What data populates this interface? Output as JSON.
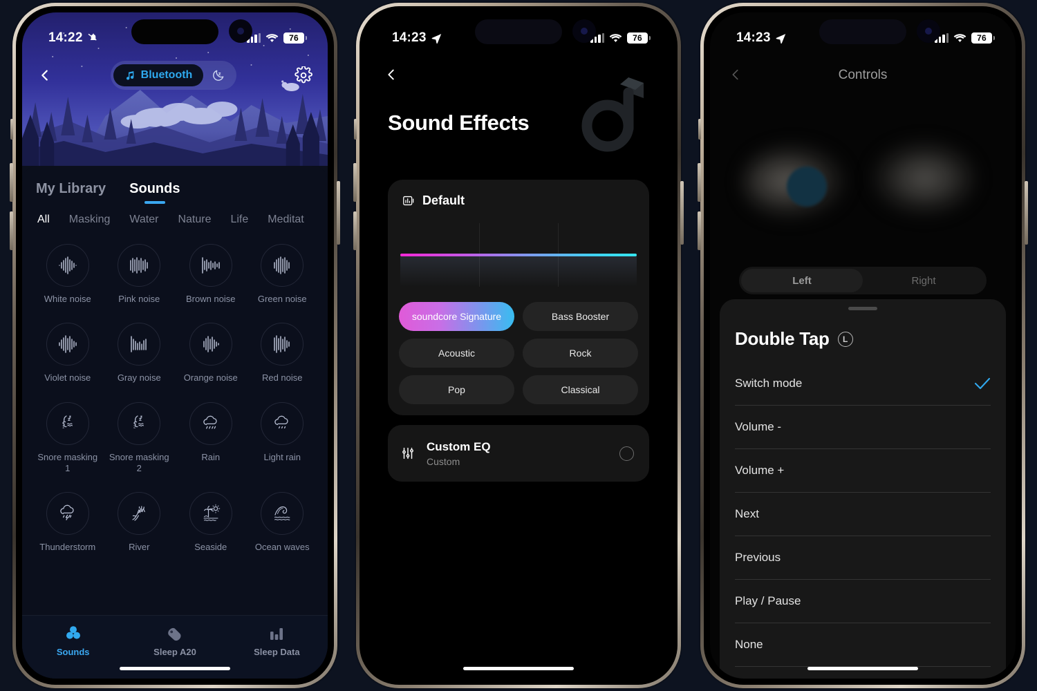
{
  "meta": {
    "background": "#0d1320",
    "accent_blue": "#3aa7f0"
  },
  "phone1": {
    "status": {
      "time": "14:22",
      "mute_icon": "bell-slash-icon",
      "battery": "76",
      "wifi_icon": "wifi-icon",
      "cell_icon": "cellular-icon"
    },
    "topbar": {
      "back_icon": "chevron-left-icon",
      "mode_label": "Bluetooth",
      "music_icon": "music-note-icon",
      "moon_icon": "moon-sleep-icon",
      "settings_icon": "gear-icon"
    },
    "tabs": [
      {
        "label": "My Library",
        "active": false
      },
      {
        "label": "Sounds",
        "active": true
      }
    ],
    "categories": [
      {
        "label": "All",
        "active": true
      },
      {
        "label": "Masking",
        "active": false
      },
      {
        "label": "Water",
        "active": false
      },
      {
        "label": "Nature",
        "active": false
      },
      {
        "label": "Life",
        "active": false
      },
      {
        "label": "Meditat",
        "active": false
      }
    ],
    "sounds": [
      {
        "label": "White noise",
        "icon": "waveform-icon"
      },
      {
        "label": "Pink noise",
        "icon": "waveform-icon"
      },
      {
        "label": "Brown noise",
        "icon": "waveform-icon"
      },
      {
        "label": "Green noise",
        "icon": "waveform-icon"
      },
      {
        "label": "Violet noise",
        "icon": "waveform-icon"
      },
      {
        "label": "Gray noise",
        "icon": "waveform-icon"
      },
      {
        "label": "Orange noise",
        "icon": "waveform-icon"
      },
      {
        "label": "Red noise",
        "icon": "waveform-icon"
      },
      {
        "label": "Snore masking 1",
        "icon": "snore-1-icon"
      },
      {
        "label": "Snore masking 2",
        "icon": "snore-2-icon"
      },
      {
        "label": "Rain",
        "icon": "rain-cloud-icon"
      },
      {
        "label": "Light rain",
        "icon": "light-rain-cloud-icon"
      },
      {
        "label": "Thunderstorm",
        "icon": "thunderstorm-icon"
      },
      {
        "label": "River",
        "icon": "river-icon"
      },
      {
        "label": "Seaside",
        "icon": "palm-beach-icon"
      },
      {
        "label": "Ocean waves",
        "icon": "ocean-waves-icon"
      }
    ],
    "tabbar": [
      {
        "label": "Sounds",
        "icon": "sounds-trefoil-icon",
        "active": true
      },
      {
        "label": "Sleep A20",
        "icon": "earbud-icon",
        "active": false
      },
      {
        "label": "Sleep Data",
        "icon": "bar-chart-icon",
        "active": false
      }
    ]
  },
  "phone2": {
    "status": {
      "time": "14:23",
      "location_icon": "location-arrow-icon",
      "battery": "76"
    },
    "back_icon": "chevron-left-icon",
    "title": "Sound Effects",
    "brand_logo": "soundcore-d-logo",
    "eq_card": {
      "icon": "equalizer-icon",
      "name": "Default",
      "presets": [
        {
          "label": "soundcore Signature",
          "selected": true
        },
        {
          "label": "Bass Booster",
          "selected": false
        },
        {
          "label": "Acoustic",
          "selected": false
        },
        {
          "label": "Rock",
          "selected": false
        },
        {
          "label": "Pop",
          "selected": false
        },
        {
          "label": "Classical",
          "selected": false
        }
      ]
    },
    "custom_row": {
      "icon": "sliders-icon",
      "title": "Custom EQ",
      "subtitle": "Custom",
      "radio": "radio-unselected-icon"
    }
  },
  "phone3": {
    "status": {
      "time": "14:23",
      "location_icon": "location-arrow-icon",
      "battery": "76"
    },
    "back_icon": "chevron-left-icon",
    "title": "Controls",
    "segmented": [
      {
        "label": "Left",
        "active": true
      },
      {
        "label": "Right",
        "active": false
      }
    ],
    "sheet": {
      "title": "Double Tap",
      "side_badge": "L",
      "clock_icon": "side-indicator-icon",
      "options": [
        {
          "label": "Switch mode",
          "selected": true
        },
        {
          "label": "Volume -",
          "selected": false
        },
        {
          "label": "Volume +",
          "selected": false
        },
        {
          "label": "Next",
          "selected": false
        },
        {
          "label": "Previous",
          "selected": false
        },
        {
          "label": "Play / Pause",
          "selected": false
        },
        {
          "label": "None",
          "selected": false
        }
      ]
    }
  }
}
